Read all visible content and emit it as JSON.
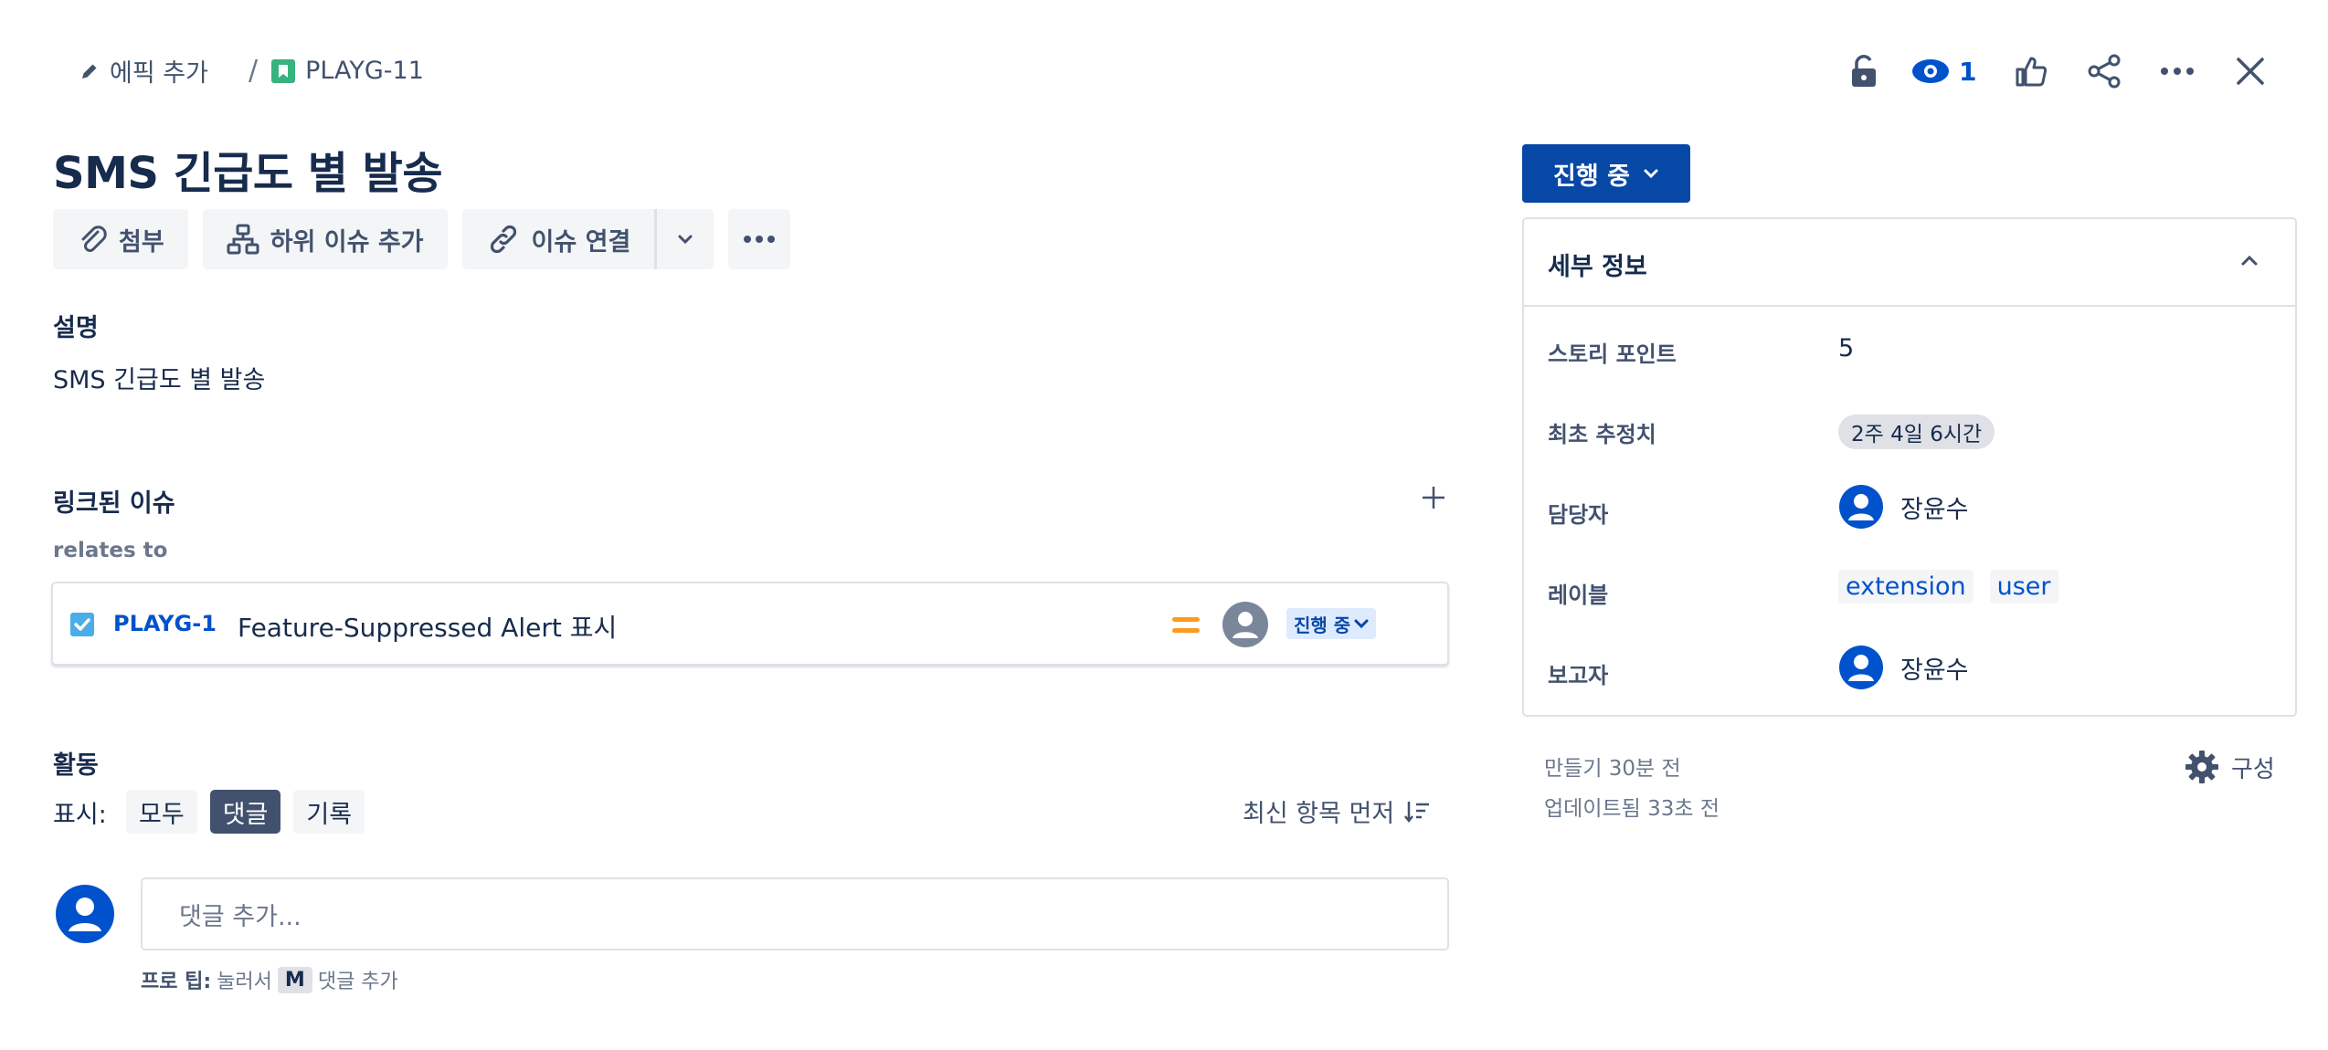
{
  "header": {
    "add_epic": "에픽 추가",
    "separator": "/",
    "issue_key": "PLAYG-11",
    "watch_count": "1"
  },
  "issue": {
    "title": "SMS 긴급도 별 발송"
  },
  "toolbar": {
    "attach": "첨부",
    "add_subtask": "하위 이슈 추가",
    "link_issue": "이슈 연결"
  },
  "description": {
    "heading": "설명",
    "text": "SMS 긴급도 별 발송"
  },
  "linked": {
    "heading": "링크된 이슈",
    "relation": "relates to",
    "items": [
      {
        "key": "PLAYG-1",
        "summary": "Feature-Suppressed Alert 표시",
        "status": "진행 중"
      }
    ]
  },
  "activity": {
    "heading": "활동",
    "show_label": "표시:",
    "filters": [
      "모두",
      "댓글",
      "기록"
    ],
    "selected_filter": "댓글",
    "sort": "최신 항목 먼저",
    "comment_placeholder": "댓글 추가...",
    "tip_bold": "프로 팁:",
    "tip_text1": "눌러서",
    "tip_key": "M",
    "tip_text2": "댓글 추가"
  },
  "status_button": "진행 중",
  "details": {
    "heading": "세부 정보",
    "story_points_label": "스토리 포인트",
    "story_points": "5",
    "estimate_label": "최초 추정치",
    "estimate": "2주 4일 6시간",
    "assignee_label": "담당자",
    "assignee": "장윤수",
    "labels_label": "레이블",
    "labels": [
      "extension",
      "user"
    ],
    "reporter_label": "보고자",
    "reporter": "장윤수"
  },
  "meta": {
    "created": "만들기 30분 전",
    "updated": "업데이트됨 33초 전",
    "configure": "구성"
  },
  "colors": {
    "primary": "#0052cc",
    "status_button": "#0747a6",
    "text": "#172b4d",
    "subtle": "#42526e",
    "priority": "#ff991f",
    "story_green": "#36b37e"
  }
}
